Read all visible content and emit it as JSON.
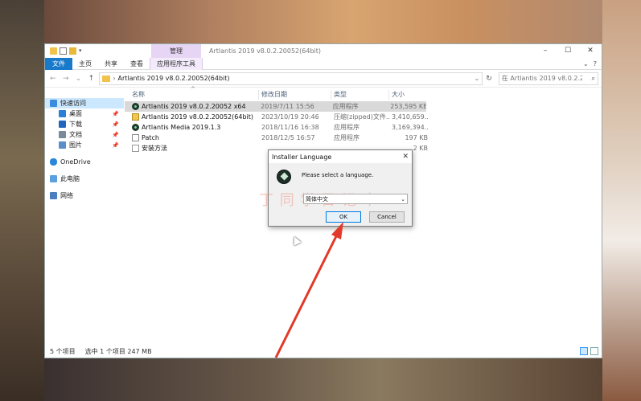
{
  "window": {
    "title": "Artlantis 2019 v8.0.2.20052(64bit)",
    "contextual_tab_group": "管理",
    "controls": [
      "–",
      "☐",
      "✕"
    ]
  },
  "ribbon": {
    "tabs": [
      "文件",
      "主页",
      "共享",
      "查看",
      "应用程序工具"
    ],
    "right": [
      "⌄",
      "?"
    ]
  },
  "address": {
    "back": "←",
    "forward": "→",
    "recent": "⌄",
    "up": "↑",
    "path_sep": "›",
    "path": "Artlantis 2019 v8.0.2.20052(64bit)",
    "dropdown": "⌄",
    "refresh": "↻",
    "search_placeholder": "在 Artlantis 2019 v8.0.2.200...",
    "search_icon": "⌕"
  },
  "nav": {
    "pin_glyph": "📌",
    "quick_access": "快速访问",
    "quick_items": [
      {
        "label": "桌面",
        "pinned": true,
        "color": "#2c7fd6"
      },
      {
        "label": "下载",
        "pinned": true,
        "color": "#2266bb"
      },
      {
        "label": "文档",
        "pinned": true,
        "color": "#7a8a9a"
      },
      {
        "label": "图片",
        "pinned": true,
        "color": "#5b8fc7"
      }
    ],
    "onedrive": "OneDrive",
    "this_pc": "此电脑",
    "network": "网络"
  },
  "columns": {
    "name": "名称",
    "date": "修改日期",
    "type": "类型",
    "size": "大小",
    "sort_indicator": "^"
  },
  "files": [
    {
      "name": "Artlantis 2019 v8.0.2.20052 x64",
      "date": "2019/7/11 15:56",
      "type": "应用程序",
      "size": "253,595 KB",
      "icon": "app",
      "selected": true
    },
    {
      "name": "Artlantis 2019 v8.0.2.20052(64bit)",
      "date": "2023/10/19 20:46",
      "type": "压缩(zipped)文件...",
      "size": "3,410,659...",
      "icon": "zip",
      "selected": false
    },
    {
      "name": "Artlantis Media 2019.1.3",
      "date": "2018/11/16 16:38",
      "type": "应用程序",
      "size": "3,169,394...",
      "icon": "app",
      "selected": false
    },
    {
      "name": "Patch",
      "date": "2018/12/5 16:57",
      "type": "应用程序",
      "size": "197 KB",
      "icon": "exe",
      "selected": false
    },
    {
      "name": "安装方法",
      "date": "",
      "type": "",
      "size": "2 KB",
      "icon": "txt",
      "selected": false
    }
  ],
  "status": {
    "count": "5 个项目",
    "selection": "选中 1 个项目  247 MB"
  },
  "dialog": {
    "title": "Installer Language",
    "close": "✕",
    "message": "Please select a language.",
    "watermark": "丁 同 学 日 记 本",
    "selected_language": "简体中文",
    "dropdown_glyph": "⌄",
    "ok": "OK",
    "cancel": "Cancel"
  },
  "annotation_color": "#e23a2a"
}
